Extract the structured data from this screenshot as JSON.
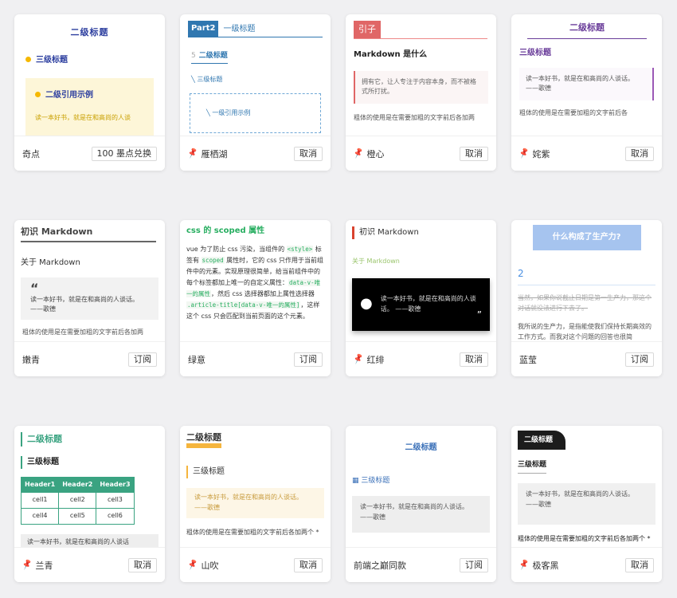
{
  "cards": [
    {
      "name": "奇点",
      "button": "100 墨点兑换",
      "pinned": false,
      "preview": {
        "h2": "二级标题",
        "h3": "三级标题",
        "box_title": "二级引用示例",
        "box_text": "读一本好书，就是在和高尚的人谈"
      }
    },
    {
      "name": "雁栖湖",
      "button": "取消",
      "pinned": true,
      "preview": {
        "part": "Part2",
        "h1": "一级标题",
        "num": "5",
        "h2": "二级标题",
        "h3": "三级标题",
        "quote": "一级引用示例"
      }
    },
    {
      "name": "橙心",
      "button": "取消",
      "pinned": true,
      "preview": {
        "tag": "引子",
        "h": "Markdown 是什么",
        "quote": "拥有它，让人专注于内容本身，而不被格式所打扰。",
        "para": "粗体的使用是在需要加粗的文字前后各加两"
      }
    },
    {
      "name": "姹紫",
      "button": "取消",
      "pinned": true,
      "preview": {
        "h2": "二级标题",
        "h3": "三级标题",
        "quote": "读一本好书，就是在和高尚的人谈话。 ——歌德",
        "para": "粗体的使用是在需要加粗的文字前后各"
      }
    },
    {
      "name": "嫩青",
      "button": "订阅",
      "pinned": false,
      "preview": {
        "h1": "初识 Markdown",
        "h2": "关于 Markdown",
        "mark": "“",
        "quote": "读一本好书，就是在和高尚的人谈话。 ——歌德",
        "para": "粗体的使用是在需要加粗的文字前后各加两"
      }
    },
    {
      "name": "绿意",
      "button": "订阅",
      "pinned": false,
      "preview": {
        "h": "css 的 scoped 属性",
        "parts": [
          "vue 为了防止 css 污染，当组件的 ",
          "<style>",
          " 标签有 ",
          "scoped",
          " 属性时，它的 css 只作用于当前组件中的元素。实现原理很简单，给当前组件中的每个标签都加上唯一的自定义属性：",
          "data-v-唯一的属性",
          "，然后 css 选择器都加上属性选择器 ",
          ".article-title[data-v-唯一的属性]",
          "，这样这个 css 只会匹配到当前页面的这个元素。"
        ]
      }
    },
    {
      "name": "红绯",
      "button": "取消",
      "pinned": true,
      "preview": {
        "h": "初识 Markdown",
        "h3": "关于 Markdown",
        "quote": "读一本好书，就是在和高尚的人谈话。 ——歌德",
        "qm": "”"
      }
    },
    {
      "name": "蓝莹",
      "button": "订阅",
      "pinned": false,
      "preview": {
        "banner": "什么构成了生产力?",
        "num": "2",
        "strike": "当然，如果你说截止日期是第一生产力，那这个对话就没法进行下去了。",
        "para": "我所说的生产力，是指能使我们保持长期高效的工作方式。而我对这个问题的回答也很简"
      }
    },
    {
      "name": "兰青",
      "button": "取消",
      "pinned": true,
      "preview": {
        "h2": "二级标题",
        "h3": "三级标题",
        "headers": [
          "Header1",
          "Header2",
          "Header3"
        ],
        "rows": [
          [
            "cell1",
            "cell2",
            "cell3"
          ],
          [
            "cell4",
            "cell5",
            "cell6"
          ]
        ],
        "quote": "读一本好书，就是在和高尚的人谈话"
      }
    },
    {
      "name": "山吹",
      "button": "取消",
      "pinned": true,
      "preview": {
        "h2": "二级标题",
        "h3": "三级标题",
        "quote": "读一本好书，就是在和高尚的人谈话。 ——歌德",
        "para": "粗体的使用是在需要加粗的文字前后各加两个 *"
      }
    },
    {
      "name": "前端之巅同款",
      "button": "订阅",
      "pinned": false,
      "preview": {
        "h2": "二级标题",
        "h3": "三级标题",
        "quote": "读一本好书，就是在和高尚的人谈话。 ——歌德"
      }
    },
    {
      "name": "极客黑",
      "button": "取消",
      "pinned": true,
      "preview": {
        "h2": "二级标题",
        "h3": "三级标题",
        "quote": "读一本好书，就是在和高尚的人谈话。 ——歌德",
        "para": "粗体的使用是在需要加粗的文字前后各加两个 *"
      }
    }
  ],
  "colors": {
    "pin": "#1677ff",
    "background": "#f0f0f2"
  }
}
